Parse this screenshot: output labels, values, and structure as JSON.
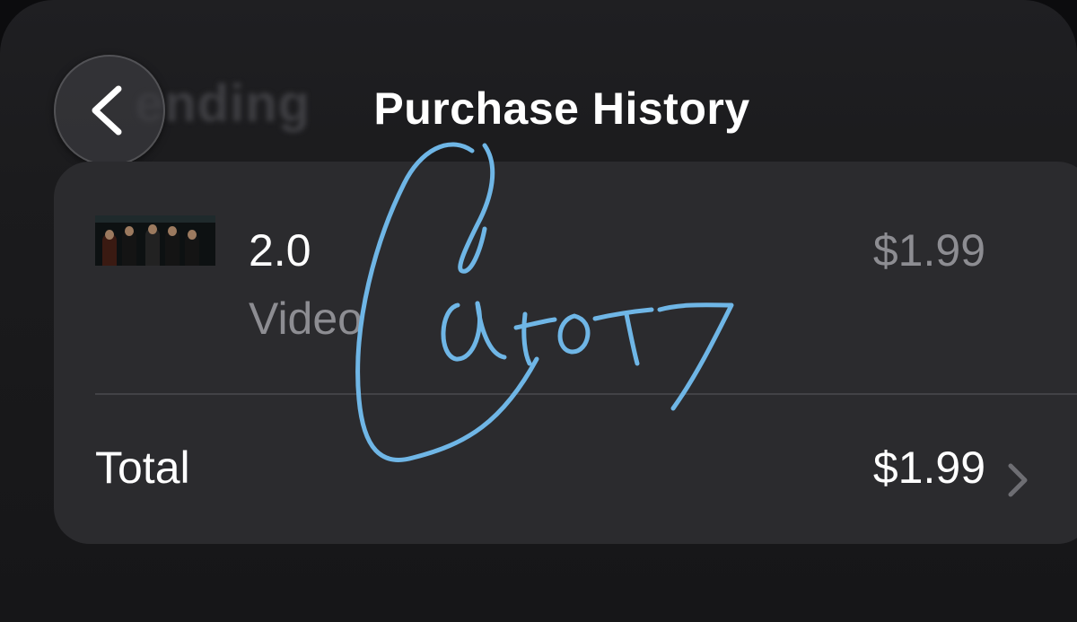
{
  "header": {
    "background_title": "ending",
    "title": "Purchase History",
    "back_icon": "chevron-left-icon"
  },
  "purchase": {
    "item": {
      "title": "2.0",
      "subtitle": "Video",
      "price": "$1.99",
      "thumbnail": "movie-poster-thumbnail"
    },
    "total": {
      "label": "Total",
      "value": "$1.99",
      "icon": "chevron-right-icon"
    }
  },
  "annotation": {
    "signature_text": "Catot7",
    "color": "#6fb6e6"
  },
  "colors": {
    "background": "#0c0c0e",
    "card": "#2b2b2e",
    "primary_text": "#ffffff",
    "secondary_text": "#8d8d92"
  }
}
